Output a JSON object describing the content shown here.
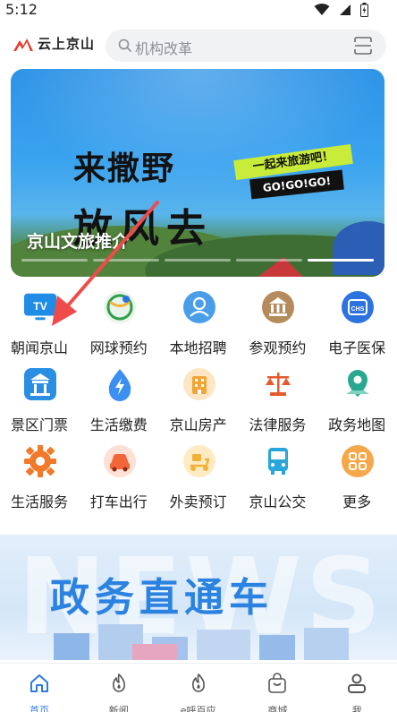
{
  "status_bar": {
    "time": "5:12"
  },
  "header": {
    "logo_text": "云上京山",
    "search": {
      "placeholder": "机构改革"
    }
  },
  "banner": {
    "headline_1": "来撒野",
    "headline_2": "放风去",
    "tag": "一起来旅游吧！",
    "go_text": "GO!GO!GO!",
    "caption": "京山文旅推介",
    "slide_count": 5,
    "active_slide": 4
  },
  "services": [
    {
      "label": "朝闻京山",
      "icon": "tv-icon",
      "color": "#1f8de6"
    },
    {
      "label": "网球预约",
      "icon": "tennis-icon",
      "color": "#2f9e4a"
    },
    {
      "label": "本地招聘",
      "icon": "person-icon",
      "color": "#4a9de8"
    },
    {
      "label": "参观预约",
      "icon": "building-icon",
      "color": "#b58a5c"
    },
    {
      "label": "电子医保",
      "icon": "medical-insurance-icon",
      "color": "#2d73e0"
    },
    {
      "label": "景区门票",
      "icon": "pavilion-icon",
      "color": "#2a8ee3"
    },
    {
      "label": "生活缴费",
      "icon": "lightning-drop-icon",
      "color": "#3a8ff0"
    },
    {
      "label": "京山房产",
      "icon": "house-icon",
      "color": "#f2a536"
    },
    {
      "label": "法律服务",
      "icon": "scales-icon",
      "color": "#e65b2d"
    },
    {
      "label": "政务地图",
      "icon": "map-pin-icon",
      "color": "#27a88f"
    },
    {
      "label": "生活服务",
      "icon": "gear-icon",
      "color": "#f07a2a"
    },
    {
      "label": "打车出行",
      "icon": "car-icon",
      "color": "#f2663a"
    },
    {
      "label": "外卖预订",
      "icon": "scooter-icon",
      "color": "#f2b23a"
    },
    {
      "label": "京山公交",
      "icon": "bus-icon",
      "color": "#2aa7d8"
    },
    {
      "label": "更多",
      "icon": "grid-more-icon",
      "color": "#f5a84a"
    }
  ],
  "news_banner": {
    "bg_text": "NEWS",
    "title": "政务直通车"
  },
  "tabbar": [
    {
      "label": "首页",
      "icon": "home-icon",
      "active": true
    },
    {
      "label": "新闻",
      "icon": "flame-icon",
      "active": false
    },
    {
      "label": "e呼百应",
      "icon": "flame-icon",
      "active": false
    },
    {
      "label": "商城",
      "icon": "shopping-bag-icon",
      "active": false
    },
    {
      "label": "我",
      "icon": "user-icon",
      "active": false
    }
  ],
  "colors": {
    "accent": "#2e7be6",
    "search_bg": "#f1f2f4"
  }
}
